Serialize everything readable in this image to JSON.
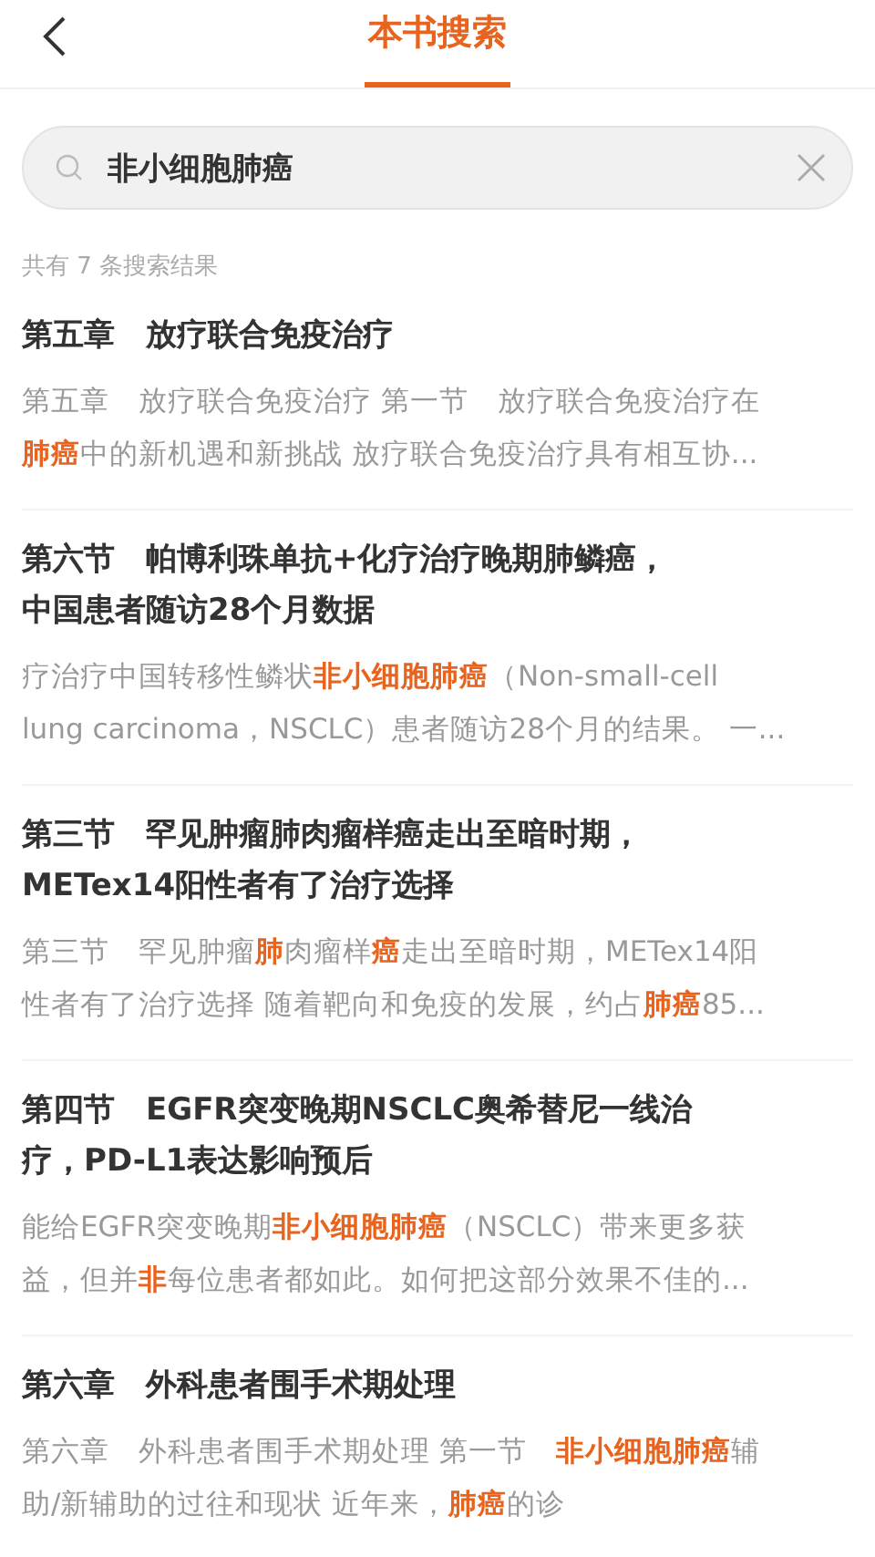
{
  "header": {
    "title": "本书搜索"
  },
  "search": {
    "value": "非小细胞肺癌"
  },
  "result_count": "共有 7 条搜索结果",
  "results": [
    {
      "title_lines": [
        "第五章　放疗联合免疫治疗"
      ],
      "snippet_lines": [
        "第五章　放疗联合免疫治疗 第一节　放疗联合免疫治疗在",
        "**肺癌**中的新机遇和新挑战 放疗联合免疫治疗具有相互协..."
      ]
    },
    {
      "title_lines": [
        "第六节　帕博利珠单抗+化疗治疗晚期肺鳞癌，",
        "中国患者随访28个月数据"
      ],
      "snippet_lines": [
        "疗治疗中国转移性鳞状**非小细胞肺癌**（Non-small-cell",
        "lung carcinoma，NSCLC）患者随访28个月的结果。 一..."
      ]
    },
    {
      "title_lines": [
        "第三节　罕见肿瘤肺肉瘤样癌走出至暗时期，",
        "METex14阳性者有了治疗选择"
      ],
      "snippet_lines": [
        "第三节　罕见肿瘤**肺**肉瘤样**癌**走出至暗时期，METex14阳",
        "性者有了治疗选择 随着靶向和免疫的发展，约占**肺癌**85..."
      ]
    },
    {
      "title_lines": [
        "第四节　EGFR突变晚期NSCLC奥希替尼一线治",
        "疗，PD-L1表达影响预后"
      ],
      "snippet_lines": [
        "能给EGFR突变晚期**非小细胞肺癌**（NSCLC）带来更多获",
        "益，但并**非**每位患者都如此。如何把这部分效果不佳的..."
      ]
    },
    {
      "title_lines": [
        "第六章　外科患者围手术期处理"
      ],
      "snippet_lines": [
        "第六章　外科患者围手术期处理 第一节　**非小细胞肺癌**辅",
        "助/新辅助的过往和现状 近年来，**肺癌**的诊"
      ]
    }
  ]
}
